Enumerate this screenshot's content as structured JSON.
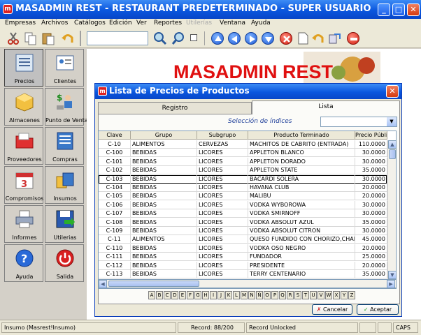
{
  "window": {
    "title": "MASADMIN REST - RESTAURANT PREDETERMINADO - SUPER USUARIO",
    "icon_letter": "m"
  },
  "menu": [
    {
      "label": "Empresas",
      "enabled": true
    },
    {
      "label": "Archivos",
      "enabled": true
    },
    {
      "label": "Catálogos",
      "enabled": true
    },
    {
      "label": "Edición",
      "enabled": true
    },
    {
      "label": "Ver",
      "enabled": true
    },
    {
      "label": "Reportes",
      "enabled": true
    },
    {
      "label": "Utilerías",
      "enabled": false
    },
    {
      "label": "Ventana",
      "enabled": true
    },
    {
      "label": "Ayuda",
      "enabled": true
    }
  ],
  "toolbar": {
    "icons": [
      "scissors-icon",
      "copy-icon",
      "paste-icon",
      "undo-icon",
      "search-icon",
      "zoom-icon",
      "checkbox-icon",
      "nav-first-icon",
      "nav-prev-icon",
      "nav-next-icon",
      "nav-last-icon",
      "delete-icon",
      "new-document-icon",
      "undo-arrow-icon",
      "refresh-icon",
      "stop-icon"
    ],
    "search_value": ""
  },
  "launcher": [
    {
      "label": "Precios",
      "icon": "price-list-icon",
      "selected": true
    },
    {
      "label": "Clientes",
      "icon": "clients-icon",
      "selected": false
    },
    {
      "label": "Almacenes",
      "icon": "warehouse-box-icon",
      "selected": false
    },
    {
      "label": "Punto de Venta",
      "icon": "pos-icon",
      "selected": false
    },
    {
      "label": "Proveedores",
      "icon": "suppliers-folder-icon",
      "selected": false
    },
    {
      "label": "Compras",
      "icon": "purchases-icon",
      "selected": false
    },
    {
      "label": "Compromisos",
      "icon": "calendar-icon",
      "selected": false
    },
    {
      "label": "Insumos",
      "icon": "supplies-icon",
      "selected": false
    },
    {
      "label": "Informes",
      "icon": "printer-icon",
      "selected": false
    },
    {
      "label": "Utilerias",
      "icon": "floppy-disk-icon",
      "selected": false
    },
    {
      "label": "Ayuda",
      "icon": "help-icon",
      "selected": false
    },
    {
      "label": "Salida",
      "icon": "power-icon",
      "selected": false
    }
  ],
  "background": {
    "title": "MASADMIN REST"
  },
  "dialog": {
    "title": "Lista de Precios de Productos",
    "icon_letter": "m",
    "tabs": [
      {
        "label": "Registro",
        "active": false
      },
      {
        "label": "Lista",
        "active": true
      }
    ],
    "index_label": "Selección de índices",
    "index_value": "",
    "columns": [
      "Clave",
      "Grupo",
      "Subgrupo",
      "Producto Terminado",
      "Precio Públi"
    ],
    "rows": [
      [
        "C-10",
        "ALIMENTOS",
        "CERVEZAS",
        "MACHITOS DE CABRITO (ENTRADA)",
        "110.0000"
      ],
      [
        "C-100",
        "BEBIDAS",
        "LICORES",
        "APPLETON BLANCO",
        "30.0000"
      ],
      [
        "C-101",
        "BEBIDAS",
        "LICORES",
        "APPLETON DORADO",
        "30.0000"
      ],
      [
        "C-102",
        "BEBIDAS",
        "LICORES",
        "APPLETON STATE",
        "35.0000"
      ],
      [
        "C-103",
        "BEBIDAS",
        "LICORES",
        "BACARDI SOLERA",
        "30.0000"
      ],
      [
        "C-104",
        "BEBIDAS",
        "LICORES",
        "HAVANA CLUB",
        "20.0000"
      ],
      [
        "C-105",
        "BEBIDAS",
        "LICORES",
        "MALIBU",
        "20.0000"
      ],
      [
        "C-106",
        "BEBIDAS",
        "LICORES",
        "VODKA WYBOROWA",
        "30.0000"
      ],
      [
        "C-107",
        "BEBIDAS",
        "LICORES",
        "VODKA SMIRNOFF",
        "30.0000"
      ],
      [
        "C-108",
        "BEBIDAS",
        "LICORES",
        "VODKA ABSOLUT AZUL",
        "35.0000"
      ],
      [
        "C-109",
        "BEBIDAS",
        "LICORES",
        "VODKA ABSOLUT CITRON",
        "30.0000"
      ],
      [
        "C-11",
        "ALIMENTOS",
        "LICORES",
        "QUESO FUNDIDO CON CHORIZO,CHAMPIÑ",
        "45.0000"
      ],
      [
        "C-110",
        "BEBIDAS",
        "LICORES",
        "VODKA OSO NEGRO",
        "20.0000"
      ],
      [
        "C-111",
        "BEBIDAS",
        "LICORES",
        "FUNDADOR",
        "25.0000"
      ],
      [
        "C-112",
        "BEBIDAS",
        "LICORES",
        "PRESIDENTE",
        "20.0000"
      ],
      [
        "C-113",
        "BEBIDAS",
        "LICORES",
        "TERRY CENTENARIO",
        "35.0000"
      ]
    ],
    "selected_row": 4,
    "letters": [
      "A",
      "B",
      "C",
      "D",
      "E",
      "F",
      "G",
      "H",
      "I",
      "J",
      "K",
      "L",
      "M",
      "N",
      "Ñ",
      "O",
      "P",
      "Q",
      "R",
      "S",
      "T",
      "U",
      "V",
      "W",
      "X",
      "Y",
      "Z"
    ],
    "cancel_label": "Cancelar",
    "accept_label": "Aceptar"
  },
  "status": {
    "user": "Insumo (Masrest!Insumo)",
    "record": "Record: 88/200",
    "lock": "Record Unlocked",
    "caps": "CAPS"
  },
  "colors": {
    "title_blue": "#0a56de",
    "brand_red": "#e01010",
    "face": "#ece9d8"
  }
}
